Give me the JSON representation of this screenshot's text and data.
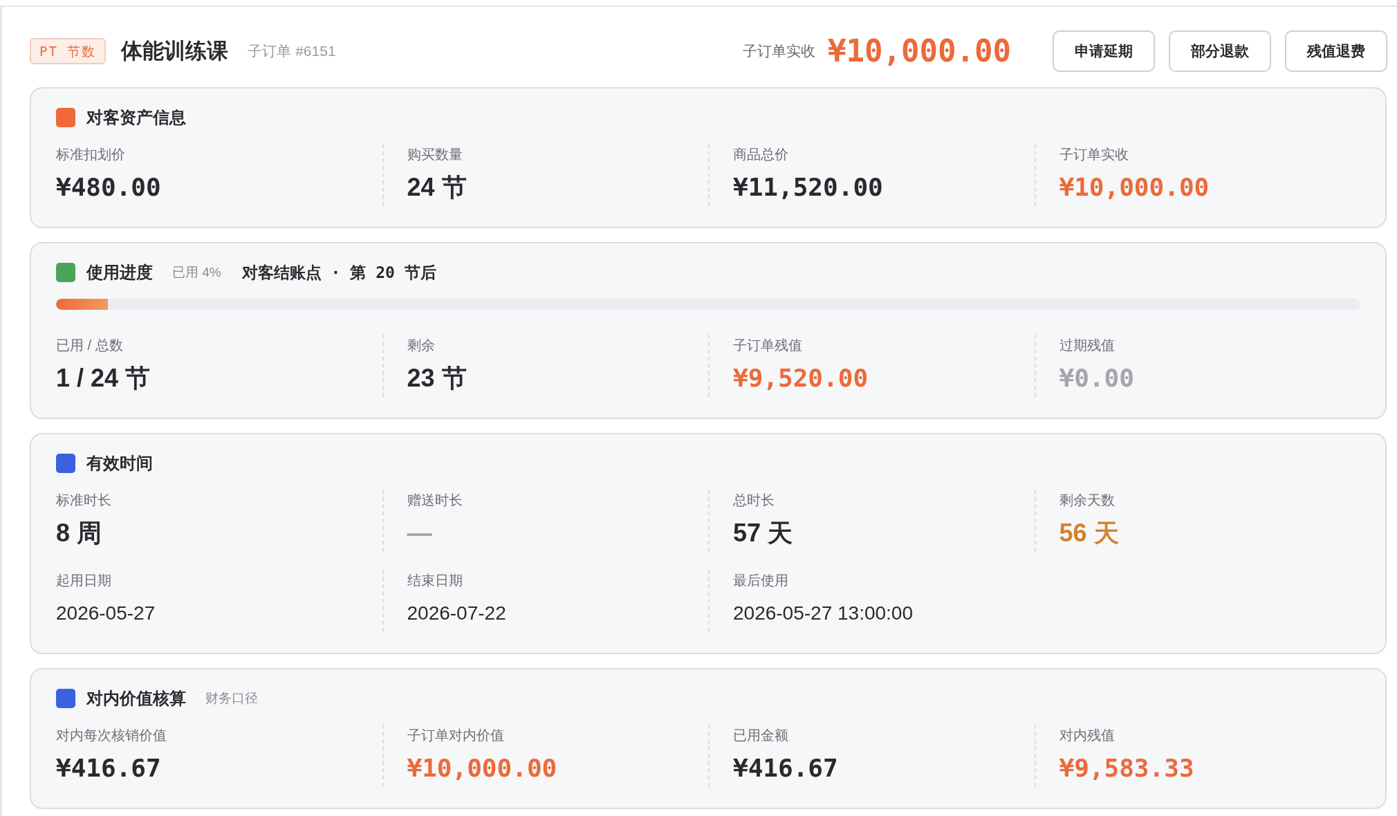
{
  "header": {
    "tag": "PT 节数",
    "title": "体能训练课",
    "sub_order": "子订单 #6151",
    "paid_label": "子订单实收",
    "paid_amount": "¥10,000.00",
    "buttons": [
      "申请延期",
      "部分退款",
      "残值退费"
    ]
  },
  "sections": [
    {
      "title": "对客资产信息",
      "color": "#ee6a3a",
      "rows": [
        [
          {
            "label": "标准扣划价",
            "value": "¥480.00",
            "kind": "money",
            "color": "#2a2a2e"
          },
          {
            "label": "购买数量",
            "value": "24 节",
            "kind": "count",
            "color": "#2a2a2e"
          },
          {
            "label": "商品总价",
            "value": "¥11,520.00",
            "kind": "money",
            "color": "#2a2a2e"
          },
          {
            "label": "子订单实收",
            "value": "¥10,000.00",
            "kind": "money",
            "color": "#ec6a3a"
          }
        ]
      ]
    },
    {
      "title": "使用进度",
      "color": "#4aa55a",
      "used_note": "已用 4%",
      "checkpoint": "对客结账点 · 第 20 节后",
      "progress": {
        "level": 0.04
      },
      "rows": [
        [
          {
            "label": "已用 / 总数",
            "value": "1 / 24 节",
            "kind": "count",
            "color": "#2a2a2e"
          },
          {
            "label": "剩余",
            "value": "23 节",
            "kind": "count",
            "color": "#2a2a2e"
          },
          {
            "label": "子订单残值",
            "value": "¥9,520.00",
            "kind": "money",
            "color": "#ec6a3a"
          },
          {
            "label": "过期残值",
            "value": "¥0.00",
            "kind": "money",
            "color": "#a5a5aa"
          }
        ]
      ]
    },
    {
      "title": "有效时间",
      "color": "#3a62e0",
      "rows": [
        [
          {
            "label": "标准时长",
            "value": "8 周",
            "kind": "count",
            "color": "#2a2a2e"
          },
          {
            "label": "赠送时长",
            "value": "—",
            "kind": "count",
            "color": "#a5a5aa"
          },
          {
            "label": "总时长",
            "value": "57 天",
            "kind": "count",
            "color": "#2a2a2e"
          },
          {
            "label": "剩余天数",
            "value": "56 天",
            "kind": "count",
            "color": "#d3822c"
          }
        ],
        [
          {
            "label": "起用日期",
            "value": "2026-05-27",
            "kind": "date",
            "color": "#2a2a2e"
          },
          {
            "label": "结束日期",
            "value": "2026-07-22",
            "kind": "date",
            "color": "#2a2a2e"
          },
          {
            "label": "最后使用",
            "value": "2026-05-27 13:00:00",
            "kind": "date",
            "color": "#2a2a2e"
          }
        ]
      ]
    },
    {
      "title": "对内价值核算",
      "color": "#3a62e0",
      "note": "财务口径",
      "rows": [
        [
          {
            "label": "对内每次核销价值",
            "value": "¥416.67",
            "kind": "money",
            "color": "#2a2a2e"
          },
          {
            "label": "子订单对内价值",
            "value": "¥10,000.00",
            "kind": "money",
            "color": "#ec6a3a"
          },
          {
            "label": "已用金额",
            "value": "¥416.67",
            "kind": "money",
            "color": "#2a2a2e"
          },
          {
            "label": "对内残值",
            "value": "¥9,583.33",
            "kind": "money",
            "color": "#ec6a3a"
          }
        ]
      ]
    }
  ]
}
